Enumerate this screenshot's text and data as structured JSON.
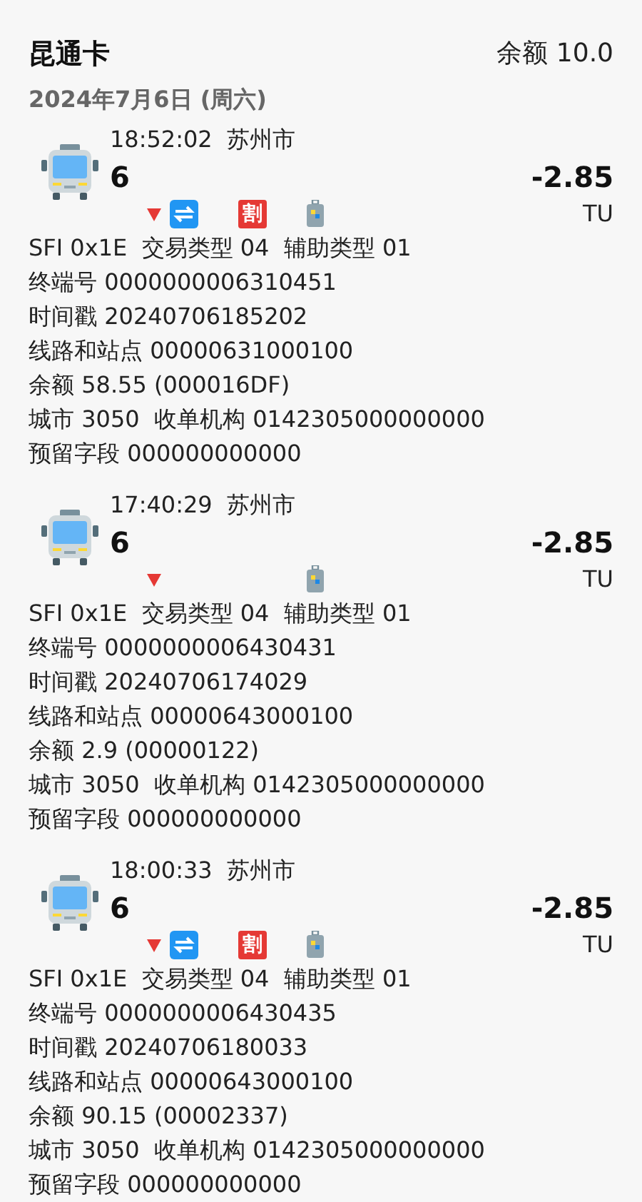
{
  "header": {
    "title": "昆通卡",
    "balance": "余额 10.0"
  },
  "date": "2024年7月6日 (周六)",
  "records": [
    {
      "time": "18:52:02",
      "city": "苏州市",
      "route": "6",
      "amount": "-2.85",
      "unit": "TU",
      "transfer": true,
      "discount_badge": "割",
      "details": [
        "SFI 0x1E  交易类型 04  辅助类型 01",
        "终端号 0000000006310451",
        "时间戳 20240706185202",
        "线路和站点 00000631000100",
        "余额 58.55 (000016DF)",
        "城市 3050  收单机构 0142305000000000",
        "预留字段 000000000000"
      ]
    },
    {
      "time": "17:40:29",
      "city": "苏州市",
      "route": "6",
      "amount": "-2.85",
      "unit": "TU",
      "transfer": false,
      "details": [
        "SFI 0x1E  交易类型 04  辅助类型 01",
        "终端号 0000000006430431",
        "时间戳 20240706174029",
        "线路和站点 00000643000100",
        "余额 2.9 (00000122)",
        "城市 3050  收单机构 0142305000000000",
        "预留字段 000000000000"
      ]
    },
    {
      "time": "18:00:33",
      "city": "苏州市",
      "route": "6",
      "amount": "-2.85",
      "unit": "TU",
      "transfer": true,
      "discount_badge": "割",
      "details": [
        "SFI 0x1E  交易类型 04  辅助类型 01",
        "终端号 0000000006430435",
        "时间戳 20240706180033",
        "线路和站点 00000643000100",
        "余额 90.15 (00002337)",
        "城市 3050  收单机构 0142305000000000",
        "预留字段 000000000000"
      ]
    }
  ]
}
